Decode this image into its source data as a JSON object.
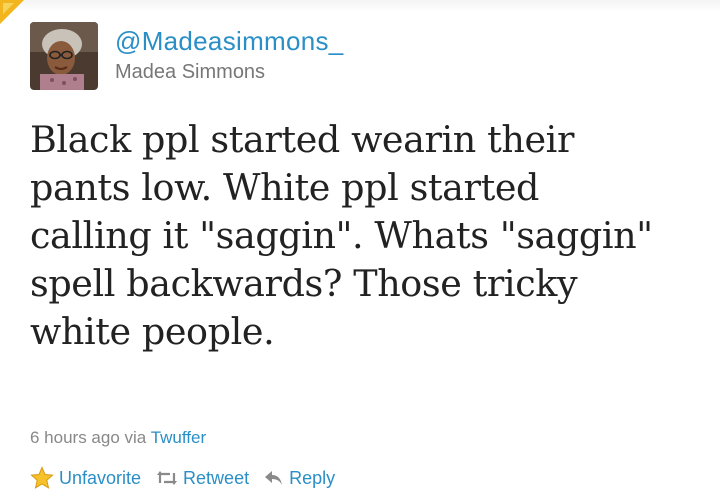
{
  "tweet": {
    "handle": "@Madeasimmons_",
    "display_name": "Madea Simmons",
    "text_lines": [
      "Black ppl started wearin their",
      "pants low. White ppl started",
      "calling it \"saggin\". Whats \"saggin\"",
      "spell backwards? Those tricky",
      "white people."
    ],
    "timestamp": "6 hours ago",
    "via_label": "via",
    "source": "Twuffer"
  },
  "actions": {
    "favorite_label": "Unfavorite",
    "retweet_label": "Retweet",
    "reply_label": "Reply"
  },
  "icons": {
    "star": "star-icon",
    "retweet": "retweet-icon",
    "reply": "reply-icon"
  },
  "colors": {
    "link": "#2a8fc7",
    "star": "#f5c22b",
    "meta_gray": "#888888",
    "text": "#222222"
  }
}
